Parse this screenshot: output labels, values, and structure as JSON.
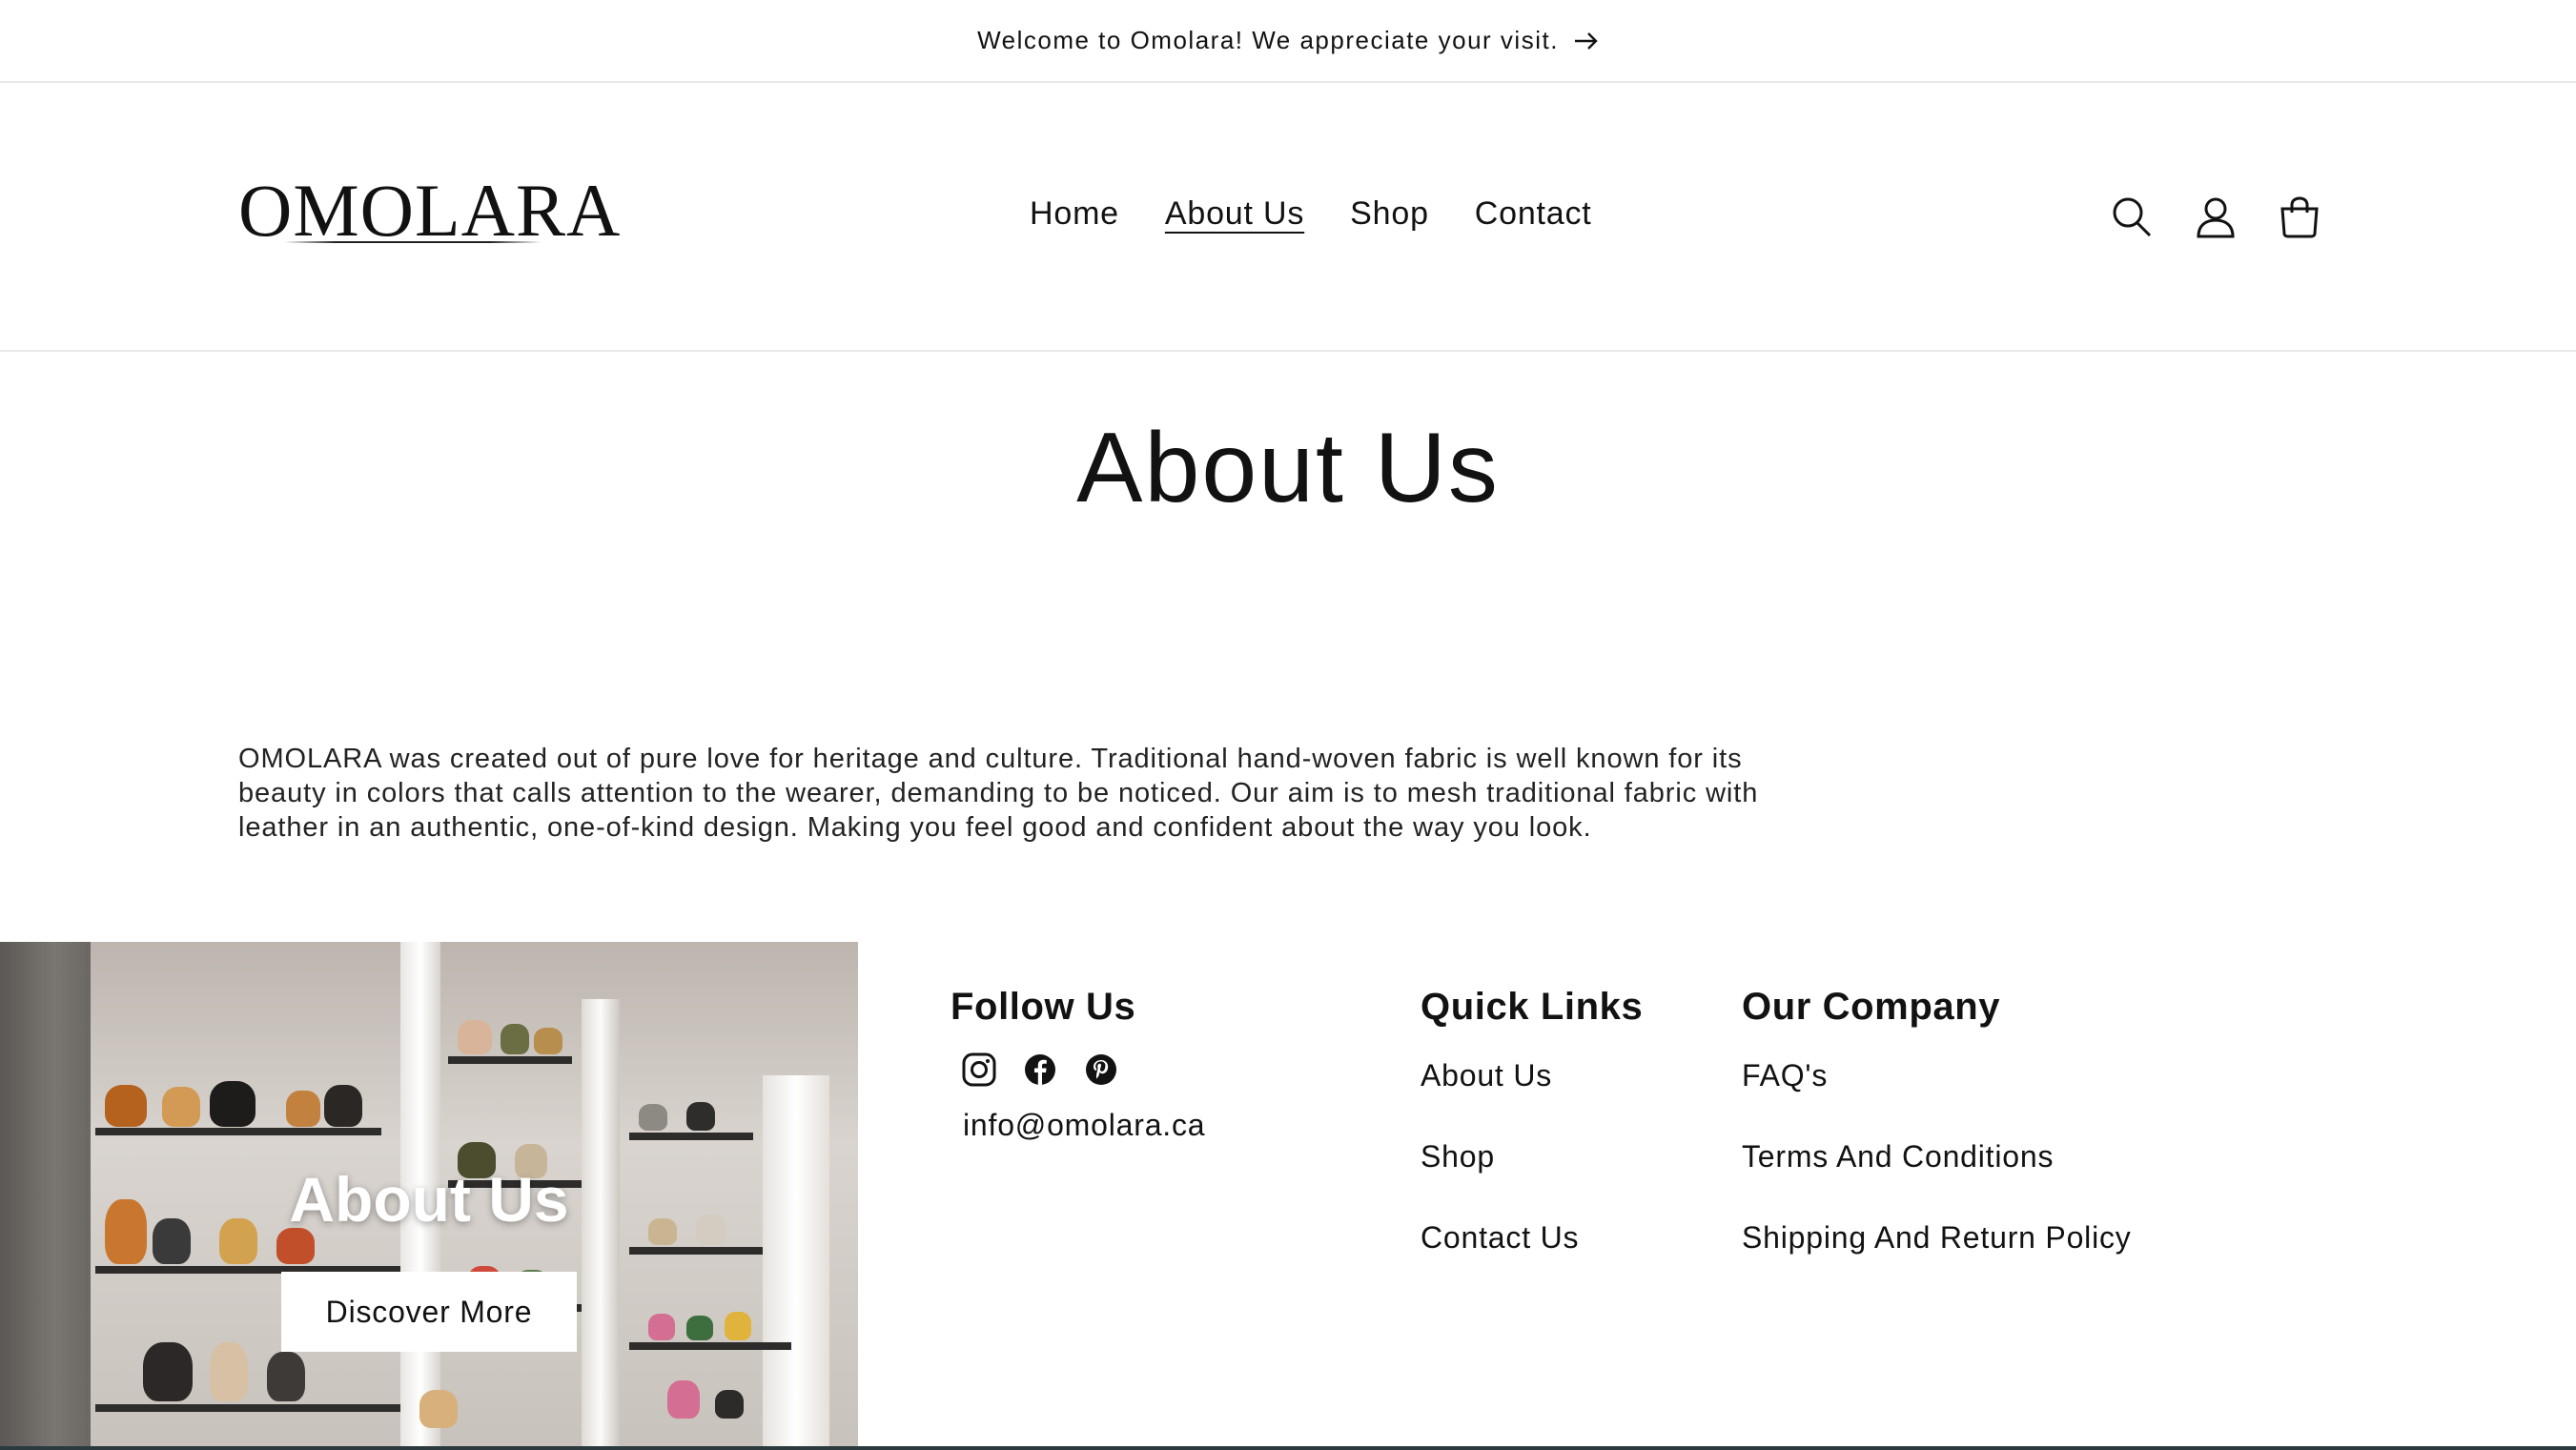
{
  "announcement": {
    "text": "Welcome to Omolara! We appreciate your visit."
  },
  "header": {
    "logo": "OMOLARA",
    "nav": [
      {
        "label": "Home"
      },
      {
        "label": "About Us",
        "active": true
      },
      {
        "label": "Shop"
      },
      {
        "label": "Contact"
      }
    ],
    "icons": [
      "search-icon",
      "account-icon",
      "cart-icon"
    ]
  },
  "main": {
    "title": "About Us",
    "body": "OMOLARA was created out of pure love for heritage and culture. Traditional hand-woven fabric is well known for its beauty in colors that calls attention to the wearer, demanding to be noticed. Our aim is to mesh traditional fabric with leather in an authentic, one-of-kind design. Making you feel good and confident about the way you look."
  },
  "promo": {
    "title": "About Us",
    "button": "Discover More"
  },
  "footer": {
    "follow": {
      "heading": "Follow Us",
      "social": [
        "instagram-icon",
        "facebook-icon",
        "pinterest-icon"
      ],
      "email": "info@omolara.ca"
    },
    "quick_links": {
      "heading": "Quick Links",
      "items": [
        "About Us",
        "Shop",
        "Contact Us"
      ]
    },
    "company": {
      "heading": "Our Company",
      "items": [
        "FAQ's",
        "Terms And Conditions",
        "Shipping And Return Policy"
      ]
    }
  }
}
